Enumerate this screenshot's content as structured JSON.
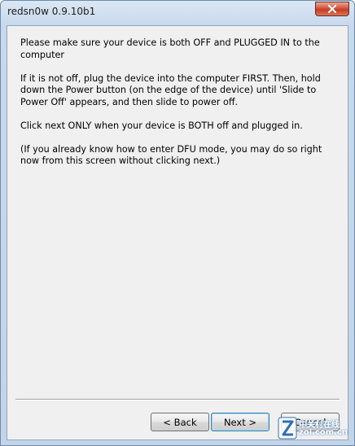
{
  "window": {
    "title": "redsn0w 0.9.10b1"
  },
  "content": {
    "paragraphs": [
      "Please make sure your device is both OFF and PLUGGED IN to the computer",
      "If it is not off, plug the device into the computer FIRST. Then, hold down the Power button (on the edge of the device) until 'Slide to Power Off' appears, and then slide to power off.",
      "Click next ONLY when your device is BOTH off and plugged in.",
      "(If you already know how to enter DFU mode, you may do so right now from this screen without clicking next.)"
    ]
  },
  "buttons": {
    "back_label": "< Back",
    "next_label": "Next >",
    "cancel_label": "Cancel"
  },
  "watermark": {
    "text_top": "中关村在线",
    "text_bottom": "zol.com.cn"
  },
  "colors": {
    "title_bar": "#c8d9ec",
    "close_button": "#c43b22",
    "client_background": "#f0f0f0",
    "default_button_border": "#3c7fb1"
  },
  "icons": {
    "close": "close-x-icon",
    "watermark_logo": "zol-logo-icon"
  }
}
